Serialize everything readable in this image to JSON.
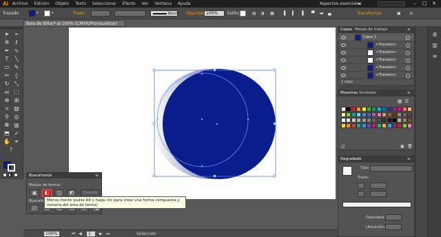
{
  "menubar": {
    "logo": "Ai",
    "items": [
      "Archivo",
      "Edición",
      "Objeto",
      "Texto",
      "Seleccionar",
      "Efecto",
      "Ver",
      "Ventana",
      "Ayuda"
    ],
    "workspace": "Aspectos esenciales"
  },
  "controlbar": {
    "selection_label": "Trazado",
    "stroke_label": "Trazo:",
    "style_preset": "Básico",
    "opacity_label": "Opacidad:",
    "opacity_value": "100%",
    "style_label": "Estilo:",
    "transform_label": "Transformar",
    "fill_color": "#0a1d8c"
  },
  "document": {
    "tab_title": "Bola de Billar* al 100% (CMYK/Previsualizar)"
  },
  "tools": [
    "select-tool",
    "direct-select-tool",
    "magic-wand-tool",
    "lasso-tool",
    "pen-tool",
    "curvature-tool",
    "type-tool",
    "line-tool",
    "rectangle-tool",
    "paintbrush-tool",
    "pencil-tool",
    "eraser-tool",
    "rotate-tool",
    "scale-tool",
    "width-tool",
    "free-transform-tool",
    "shape-builder-tool",
    "perspective-tool",
    "mesh-tool",
    "gradient-tool",
    "eyedropper-tool",
    "blend-tool",
    "symbol-sprayer-tool",
    "graph-tool",
    "artboard-tool",
    "slice-tool",
    "hand-tool",
    "zoom-tool"
  ],
  "layers_panel": {
    "tabs": [
      "Capas",
      "Mesas de trabajo"
    ],
    "rows": [
      {
        "name": "Capa 1",
        "thumb": "#0a1d8c"
      },
      {
        "name": "<Trazado>",
        "thumb": "#0a1d8c"
      },
      {
        "name": "<Trazado>",
        "thumb": "#ffffff"
      },
      {
        "name": "<Trazado>",
        "thumb": "#ffffff"
      },
      {
        "name": "<Trazado>",
        "thumb": "#0a1d8c"
      },
      {
        "name": "<Trazado>",
        "thumb": "#0a1d8c"
      }
    ],
    "footer": "1 capa"
  },
  "swatches_panel": {
    "tabs": [
      "Muestras",
      "Símbolos"
    ]
  },
  "gradient_panel": {
    "tab": "Degradado",
    "type_label": "Tipo:",
    "trazo_label": "Trazo:",
    "opacity_label": "Opacidad:",
    "location_label": "Ubicación:"
  },
  "pathfinder": {
    "title": "Buscatrazos",
    "shape_modes_label": "Modos de forma:",
    "pathfinders_label": "Buscatrazos:",
    "expand_label": "Expandir",
    "tooltip": "Menos frente (pulse Alt y haga clic para crear una forma compuesta y restarla del área de forma)"
  },
  "statusbar": {
    "zoom": "100%",
    "page": "1",
    "tool": "Selección"
  },
  "colors": {
    "ball_blue": "#0a1d8c",
    "selection": "#4a7bff",
    "app_bg": "#595959"
  }
}
